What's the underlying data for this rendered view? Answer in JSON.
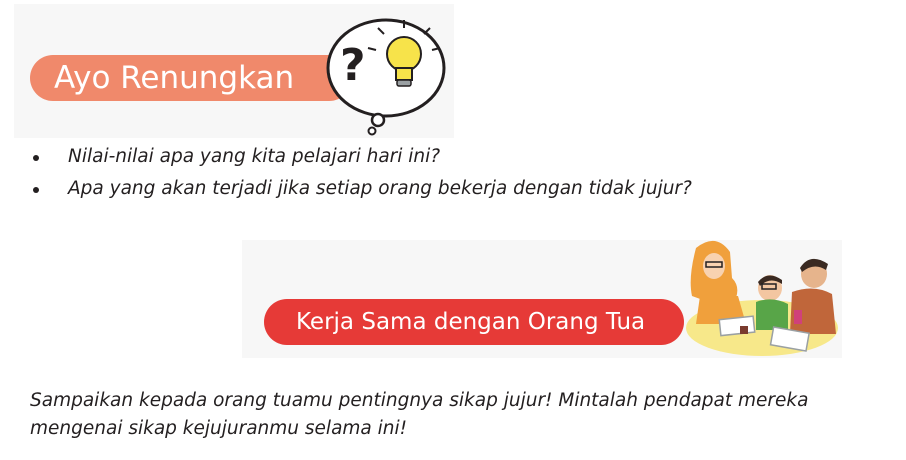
{
  "section1": {
    "title": "Ayo Renungkan",
    "questions": [
      "Nilai-nilai apa yang kita pelajari hari ini?",
      "Apa yang akan terjadi jika setiap orang bekerja dengan tidak jujur?"
    ],
    "icon": "thought-bubble-lightbulb-icon",
    "banner_color": "#f0896b"
  },
  "section2": {
    "title": "Kerja Sama dengan Orang Tua",
    "illustration": "family-illustration",
    "banner_color": "#e63a37",
    "paragraph": "Sampaikan kepada orang tuamu pentingnya sikap jujur! Mintalah pendapat mereka mengenai sikap kejujuranmu selama ini!"
  }
}
